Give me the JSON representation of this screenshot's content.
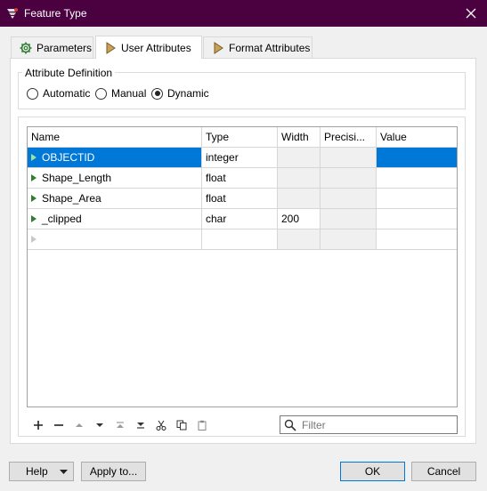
{
  "window": {
    "title": "Feature Type"
  },
  "tabs": [
    {
      "label": "Parameters"
    },
    {
      "label": "User Attributes"
    },
    {
      "label": "Format Attributes"
    }
  ],
  "attribute_definition": {
    "legend": "Attribute Definition",
    "options": [
      {
        "label": "Automatic",
        "selected": false
      },
      {
        "label": "Manual",
        "selected": false
      },
      {
        "label": "Dynamic",
        "selected": true
      }
    ]
  },
  "table": {
    "columns": [
      "Name",
      "Type",
      "Width",
      "Precisi...",
      "Value"
    ],
    "rows": [
      {
        "name": "OBJECTID",
        "type": "integer",
        "width": "",
        "precision": "",
        "value": "",
        "selected": true
      },
      {
        "name": "Shape_Length",
        "type": "float",
        "width": "",
        "precision": "",
        "value": ""
      },
      {
        "name": "Shape_Area",
        "type": "float",
        "width": "",
        "precision": "",
        "value": ""
      },
      {
        "name": "_clipped",
        "type": "char",
        "width": "200",
        "precision": "",
        "value": ""
      }
    ]
  },
  "toolbar": {
    "icons": [
      "add-icon",
      "remove-icon",
      "move-up-icon",
      "move-down-icon",
      "move-top-icon",
      "move-bottom-icon",
      "cut-icon",
      "copy-icon",
      "paste-icon"
    ]
  },
  "filter": {
    "placeholder": "Filter",
    "value": ""
  },
  "buttons": {
    "help": "Help",
    "apply_to": "Apply to...",
    "ok": "OK",
    "cancel": "Cancel"
  },
  "colors": {
    "titlebar": "#4b0040",
    "selection": "#0078d7",
    "row_arrow": "#2e7d32"
  }
}
